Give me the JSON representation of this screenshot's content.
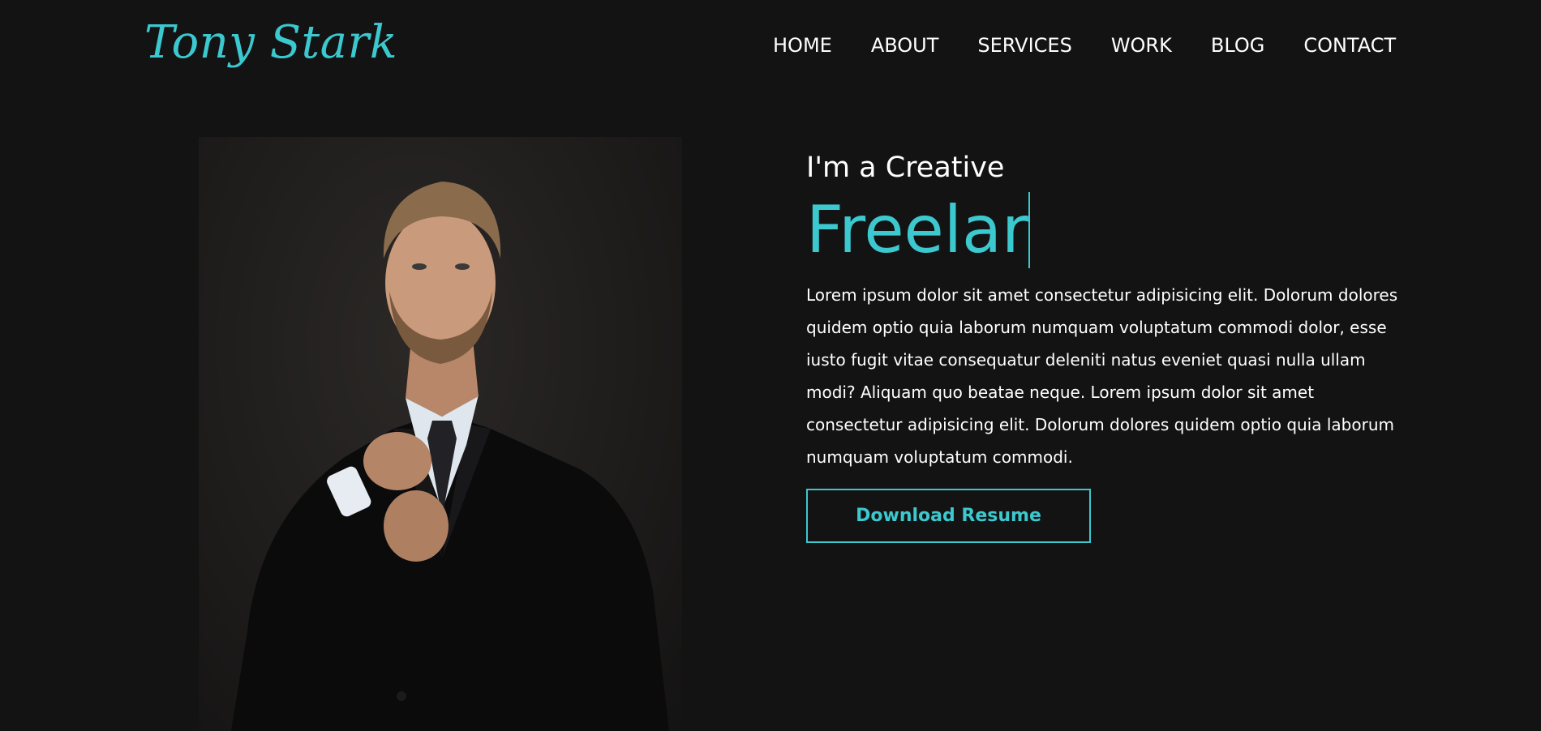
{
  "brand": {
    "name": "Tony Stark",
    "accent_color": "#3cc8cf",
    "background_color": "#131313"
  },
  "nav": {
    "items": [
      {
        "label": "HOME"
      },
      {
        "label": "ABOUT"
      },
      {
        "label": "SERVICES"
      },
      {
        "label": "WORK"
      },
      {
        "label": "BLOG"
      },
      {
        "label": "CONTACT"
      }
    ]
  },
  "hero": {
    "subtitle": "I'm a Creative",
    "typed_text": "Freelar",
    "description": "Lorem ipsum dolor sit amet consectetur adipisicing elit. Dolorum dolores quidem optio quia laborum numquam voluptatum commodi dolor, esse iusto fugit vitae consequatur deleniti natus eveniet quasi nulla ullam modi? Aliquam quo beatae neque. Lorem ipsum dolor sit amet consectetur adipisicing elit. Dolorum dolores quidem optio quia laborum numquam voluptatum commodi.",
    "button_label": "Download Resume",
    "photo": "portrait-photo"
  }
}
